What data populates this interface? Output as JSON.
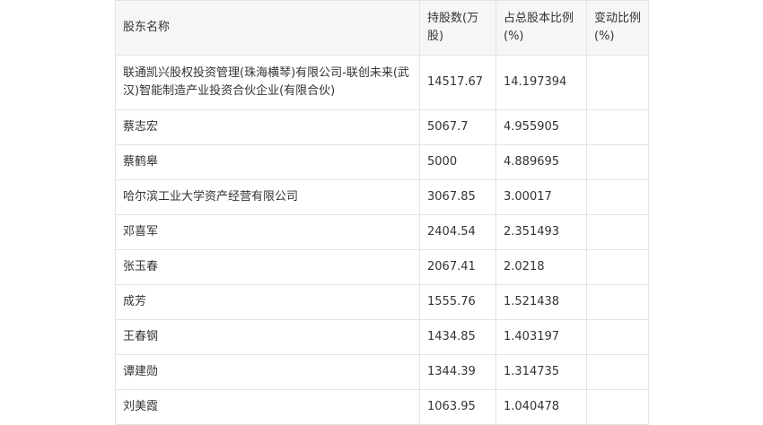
{
  "table": {
    "headers": [
      "股东名称",
      "持股数(万股)",
      "占总股本比例(%)",
      "变动比例(%)"
    ],
    "rows": [
      {
        "name": "联通凯兴股权投资管理(珠海横琴)有限公司-联创未来(武汉)智能制造产业投资合伙企业(有限合伙)",
        "shares": "14517.67",
        "ratio": "14.197394",
        "change": ""
      },
      {
        "name": "蔡志宏",
        "shares": "5067.7",
        "ratio": "4.955905",
        "change": ""
      },
      {
        "name": "蔡鹤皋",
        "shares": "5000",
        "ratio": "4.889695",
        "change": ""
      },
      {
        "name": "哈尔滨工业大学资产经营有限公司",
        "shares": "3067.85",
        "ratio": "3.00017",
        "change": ""
      },
      {
        "name": "邓喜军",
        "shares": "2404.54",
        "ratio": "2.351493",
        "change": ""
      },
      {
        "name": "张玉春",
        "shares": "2067.41",
        "ratio": "2.0218",
        "change": ""
      },
      {
        "name": "成芳",
        "shares": "1555.76",
        "ratio": "1.521438",
        "change": ""
      },
      {
        "name": "王春钢",
        "shares": "1434.85",
        "ratio": "1.403197",
        "change": ""
      },
      {
        "name": "谭建勋",
        "shares": "1344.39",
        "ratio": "1.314735",
        "change": ""
      },
      {
        "name": "刘美霞",
        "shares": "1063.95",
        "ratio": "1.040478",
        "change": ""
      }
    ]
  }
}
